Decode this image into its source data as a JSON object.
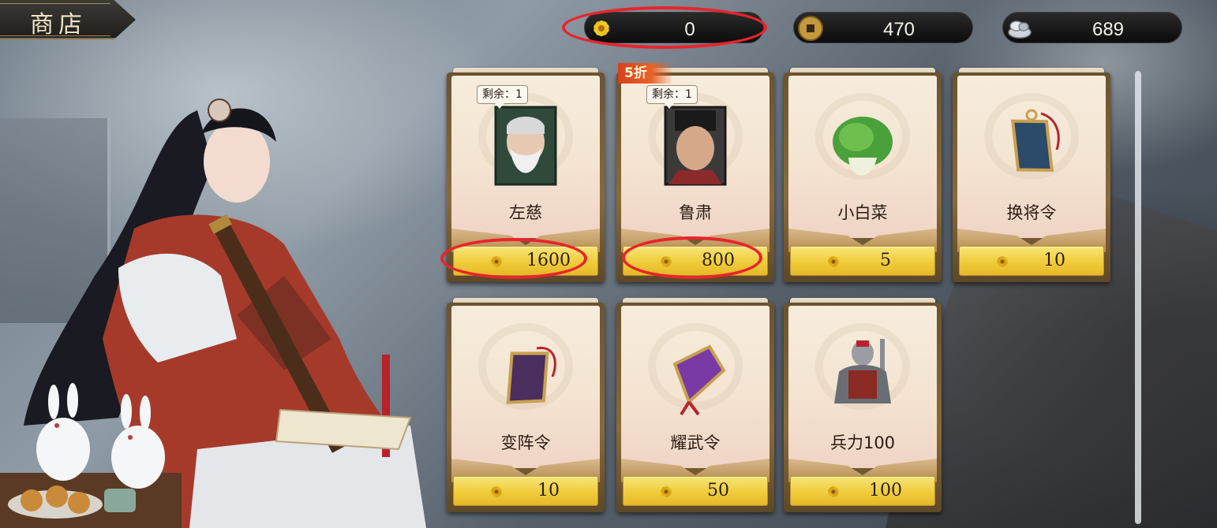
{
  "header": {
    "title": "商店"
  },
  "currencies": [
    {
      "name": "blossom",
      "value": "0",
      "icon": "gold-flower-icon"
    },
    {
      "name": "coin",
      "value": "470",
      "icon": "copper-coin-icon"
    },
    {
      "name": "silver",
      "value": "689",
      "icon": "silver-ingot-icon"
    }
  ],
  "items": [
    {
      "name": "左慈",
      "price": "1600",
      "remain": "剩余：1",
      "icon": "zuo-ci-portrait"
    },
    {
      "name": "鲁肃",
      "price": "800",
      "remain": "剩余：1",
      "discount": "5折",
      "icon": "lu-su-portrait"
    },
    {
      "name": "小白菜",
      "price": "5",
      "icon": "bok-choy-icon"
    },
    {
      "name": "换将令",
      "price": "10",
      "icon": "swap-token-icon"
    },
    {
      "name": "变阵令",
      "price": "10",
      "icon": "formation-token-icon"
    },
    {
      "name": "耀武令",
      "price": "50",
      "icon": "glory-token-icon"
    },
    {
      "name": "兵力100",
      "price": "100",
      "icon": "armor-icon"
    }
  ],
  "colors": {
    "highlight_ring": "#e8242c",
    "price_button": "#f0cc3a",
    "card_bg": "#f6ecdc"
  }
}
